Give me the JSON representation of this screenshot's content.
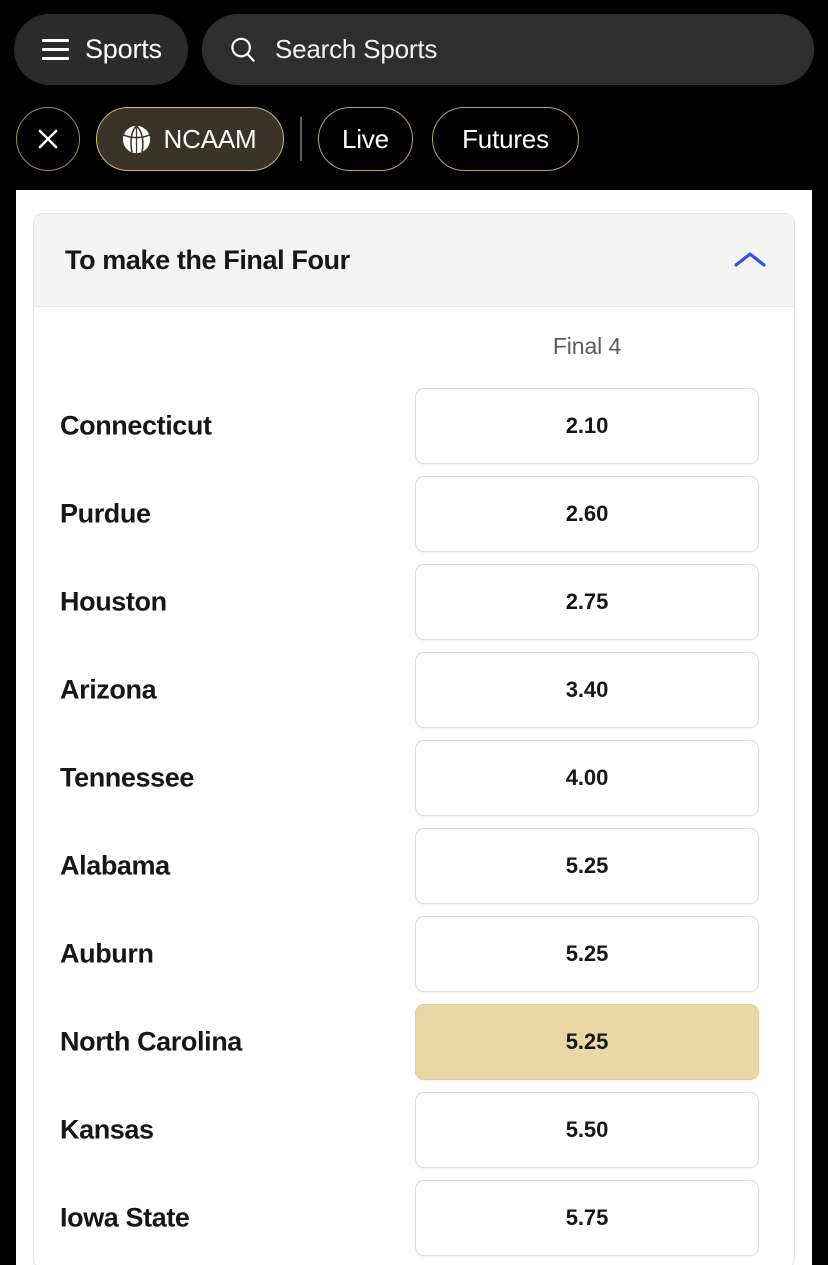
{
  "nav": {
    "menu_button_label": "Sports",
    "menu_icon": "hamburger-icon",
    "search": {
      "placeholder": "Search Sports",
      "value": "",
      "icon": "search-icon"
    },
    "filters": {
      "close_icon": "close-icon",
      "chips": [
        {
          "label": "NCAAM",
          "icon": "basketball-icon",
          "active": true
        },
        {
          "label": "Live",
          "active": false
        },
        {
          "label": "Futures",
          "active": false
        }
      ]
    }
  },
  "card": {
    "title": "To make the Final Four",
    "collapse_icon": "chevron-up-icon",
    "collapse_icon_color": "#3b4fe0",
    "column_headers": [
      "Final 4"
    ],
    "selected_color": "#e9d8a6",
    "rows": [
      {
        "team": "Connecticut",
        "odds": "2.10",
        "selected": false
      },
      {
        "team": "Purdue",
        "odds": "2.60",
        "selected": false
      },
      {
        "team": "Houston",
        "odds": "2.75",
        "selected": false
      },
      {
        "team": "Arizona",
        "odds": "3.40",
        "selected": false
      },
      {
        "team": "Tennessee",
        "odds": "4.00",
        "selected": false
      },
      {
        "team": "Alabama",
        "odds": "5.25",
        "selected": false
      },
      {
        "team": "Auburn",
        "odds": "5.25",
        "selected": false
      },
      {
        "team": "North Carolina",
        "odds": "5.25",
        "selected": true
      },
      {
        "team": "Kansas",
        "odds": "5.50",
        "selected": false
      },
      {
        "team": "Iowa State",
        "odds": "5.75",
        "selected": false
      }
    ]
  }
}
